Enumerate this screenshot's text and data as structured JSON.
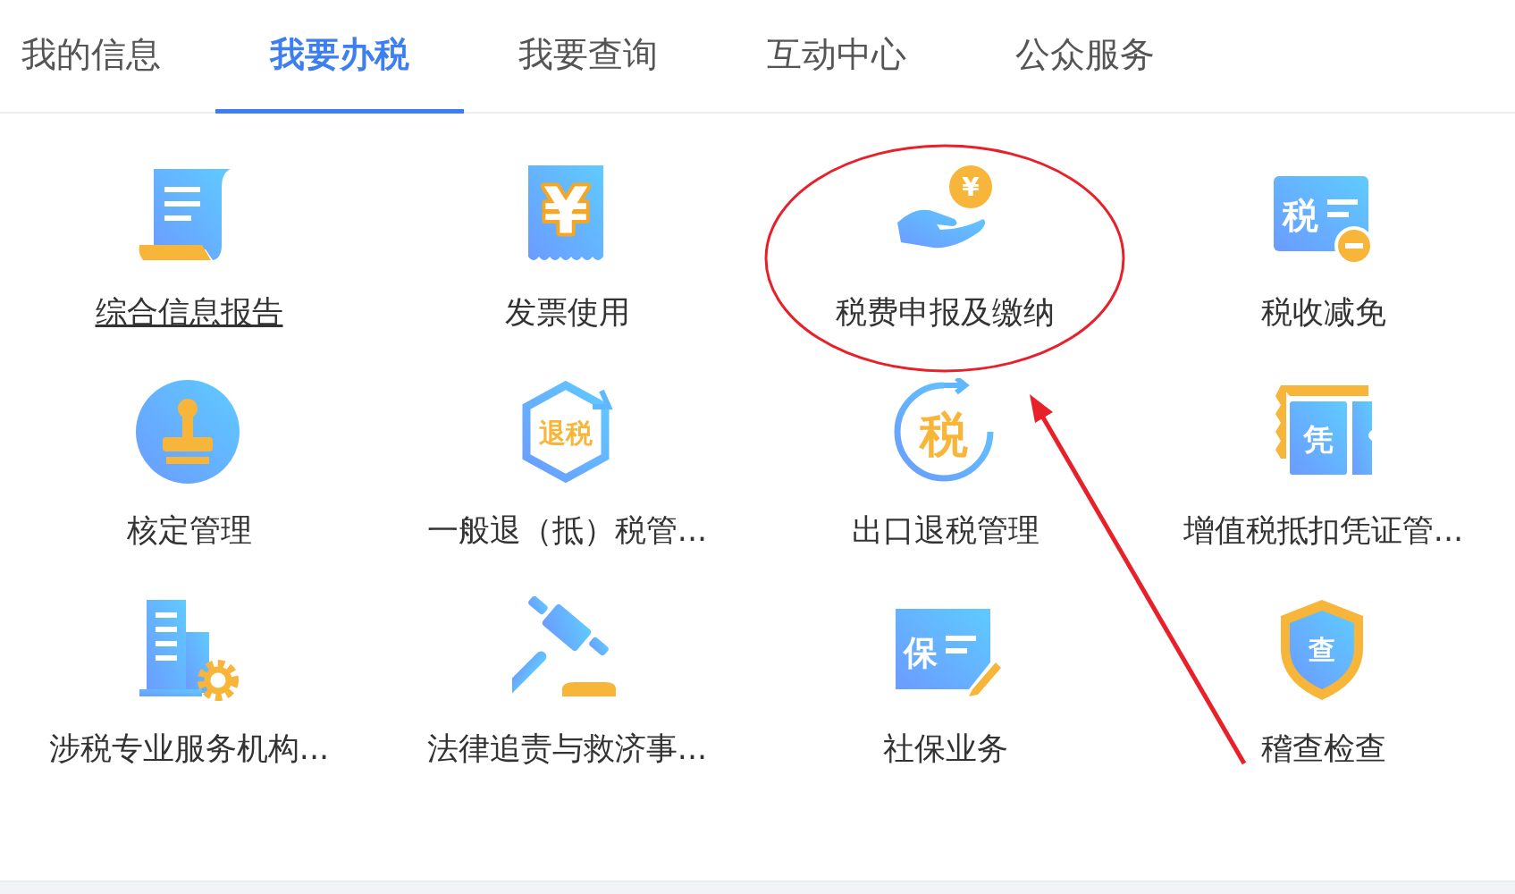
{
  "tabs": [
    {
      "label": "我的信息",
      "selected": false
    },
    {
      "label": "我要办税",
      "selected": true
    },
    {
      "label": "我要查询",
      "selected": false
    },
    {
      "label": "互动中心",
      "selected": false
    },
    {
      "label": "公众服务",
      "selected": false
    }
  ],
  "services": [
    {
      "kind": "scroll",
      "label": "综合信息报告",
      "hovered": true,
      "highlighted": false
    },
    {
      "kind": "invoice",
      "label": "发票使用",
      "icon_text": "¥",
      "hovered": false,
      "highlighted": false
    },
    {
      "kind": "hand-coin",
      "label": "税费申报及缴纳",
      "icon_text": "¥",
      "hovered": false,
      "highlighted": true
    },
    {
      "kind": "tax-minus",
      "label": "税收减免",
      "icon_text": "税",
      "hovered": false,
      "highlighted": false
    },
    {
      "kind": "stamp",
      "label": "核定管理",
      "hovered": false,
      "highlighted": false
    },
    {
      "kind": "hex-refund",
      "label": "一般退（抵）税管...",
      "icon_text": "退税",
      "hovered": false,
      "highlighted": false
    },
    {
      "kind": "circle-refund",
      "label": "出口退税管理",
      "icon_text": "税",
      "hovered": false,
      "highlighted": false
    },
    {
      "kind": "voucher",
      "label": "增值税抵扣凭证管...",
      "icon_text": "凭",
      "hovered": false,
      "highlighted": false
    },
    {
      "kind": "building-gear",
      "label": "涉税专业服务机构...",
      "hovered": false,
      "highlighted": false
    },
    {
      "kind": "gavel",
      "label": "法律追责与救济事...",
      "hovered": false,
      "highlighted": false
    },
    {
      "kind": "social-card",
      "label": "社保业务",
      "icon_text": "保",
      "hovered": false,
      "highlighted": false
    },
    {
      "kind": "shield",
      "label": "稽查检查",
      "icon_text": "查",
      "hovered": false,
      "highlighted": false
    }
  ]
}
